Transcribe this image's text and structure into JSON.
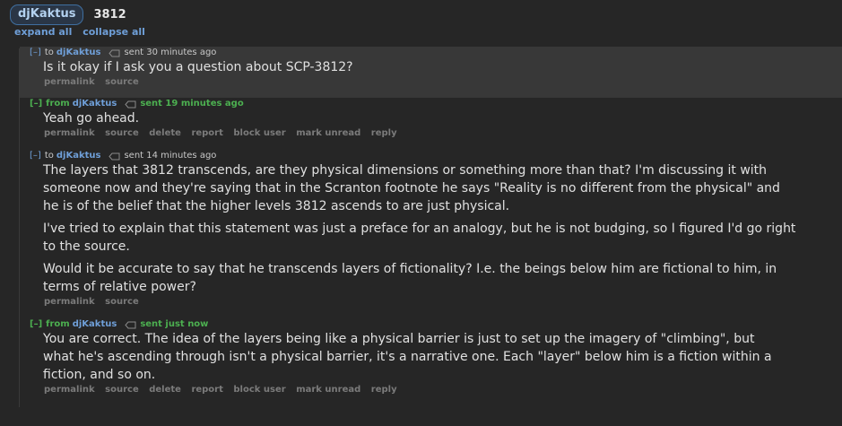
{
  "header": {
    "username": "djKaktus",
    "subject": "3812"
  },
  "controls": {
    "expand_all": "expand all",
    "collapse_all": "collapse all"
  },
  "messages": [
    {
      "collapse": "[–]",
      "direction": "to",
      "author": "djKaktus",
      "time": "sent 30 minutes ago",
      "paragraphs": [
        "Is it okay if I ask you a question about SCP-3812?"
      ],
      "actions": [
        "permalink",
        "source"
      ]
    },
    {
      "collapse": "[–]",
      "direction": "from",
      "author": "djKaktus",
      "time": "sent 19 minutes ago",
      "paragraphs": [
        "Yeah go ahead."
      ],
      "actions": [
        "permalink",
        "source",
        "delete",
        "report",
        "block user",
        "mark unread",
        "reply"
      ]
    },
    {
      "collapse": "[–]",
      "direction": "to",
      "author": "djKaktus",
      "time": "sent 14 minutes ago",
      "paragraphs": [
        "The layers that 3812 transcends, are they physical dimensions or something more than that? I'm discussing it with someone now and they're saying that in the Scranton footnote he says \"Reality is no different from the physical\" and he is of the belief that the higher levels 3812 ascends to are just physical.",
        "I've tried to explain that this statement was just a preface for an analogy, but he is not budging, so I figured I'd go right to the source.",
        "Would it be accurate to say that he transcends layers of fictionality? I.e. the beings below him are fictional to him, in terms of relative power?"
      ],
      "actions": [
        "permalink",
        "source"
      ]
    },
    {
      "collapse": "[–]",
      "direction": "from",
      "author": "djKaktus",
      "time": "sent just now",
      "paragraphs": [
        "You are correct. The idea of the layers being like a physical barrier is just to set up the imagery of \"climbing\", but what he's ascending through isn't a physical barrier, it's a narrative one. Each \"layer\" below him is a fiction within a fiction, and so on."
      ],
      "actions": [
        "permalink",
        "source",
        "delete",
        "report",
        "block user",
        "mark unread",
        "reply"
      ]
    }
  ]
}
